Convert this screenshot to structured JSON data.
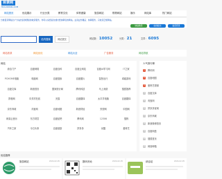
{
  "header": {
    "logo_text": "目录网",
    "logo_sub": "MULUWANG.COM"
  },
  "nav": {
    "items": [
      "网站首页",
      "优站展示",
      "行业分类",
      "教育文化",
      "体育健康",
      "旅游网站",
      "购物网站",
      "娱乐",
      "网站库",
      "热门网站"
    ]
  },
  "notice": {
    "text": "分类目录网站为广大站长提供便捷的收录服务，你可以免费提交或付费快审您的网站，主营业务覆盖：快审服务，只收录正规网站。",
    "pills": [
      "快速收录",
      "在线提交",
      "会员登录"
    ]
  },
  "search": {
    "placeholder": "",
    "button_label": "站内搜索",
    "button2_label": "网站提交",
    "stats": [
      {
        "label": "网站数：",
        "value": "10052"
      },
      {
        "label": "分类：",
        "value": "21"
      },
      {
        "label": "文章：",
        "value": "6095"
      }
    ]
  },
  "quickbar": {
    "items": [
      "网站收录",
      "网站优化",
      "网站大全",
      "广告服务",
      "网站导航"
    ]
  },
  "main": {
    "title": "网站",
    "cells": [
      "综合门户",
      "百度网络",
      "百度百科",
      "百度云网站",
      "百度AI学习网",
      "IT之家",
      "PCHOME电脑",
      "电脑网",
      "百度搜索",
      "百度图片",
      "智慧出行",
      "卓越游戏",
      "百度文库",
      "新浪首页",
      "国家统计局",
      "腾讯科技",
      "马上消费",
      "搜狐推荐",
      "携程网",
      "中关村在线",
      "天猫",
      "百度翻译",
      "太平洋电脑",
      "百度翻译",
      "京东商城",
      "淘宝网",
      "百度地图",
      "新浪财经",
      "央视网",
      "中国网",
      "网易云音乐",
      "东方财富",
      "百度贴吧",
      "腾讯网",
      "12306",
      "搜狗",
      "汽车之家",
      "今日头条",
      "百度健康",
      "拼多多",
      "优酷",
      "爱奇艺"
    ]
  },
  "side": {
    "title": "人气排行榜",
    "items": [
      "腾讯网",
      "百度地图",
      "爱奇艺视频",
      "百度文库",
      "淘宝网",
      "拼多多官网",
      "京东商城",
      "新浪微博首页",
      "百度网盘",
      "搜狐首页",
      "网易邮箱"
    ]
  },
  "bottom": {
    "title": "优站推荐",
    "cards": [
      {
        "name": "旅游网站",
        "date": "2024-02-05"
      },
      {
        "name": "数码天地",
        "date": "2024-02-05"
      },
      {
        "name": "综合站",
        "date": "2024-02-05"
      }
    ]
  },
  "colors": {
    "brand": "#1a78d6",
    "accent_red": "#e45b3e",
    "green": "#3c9a42",
    "orange": "#f08a1c"
  }
}
